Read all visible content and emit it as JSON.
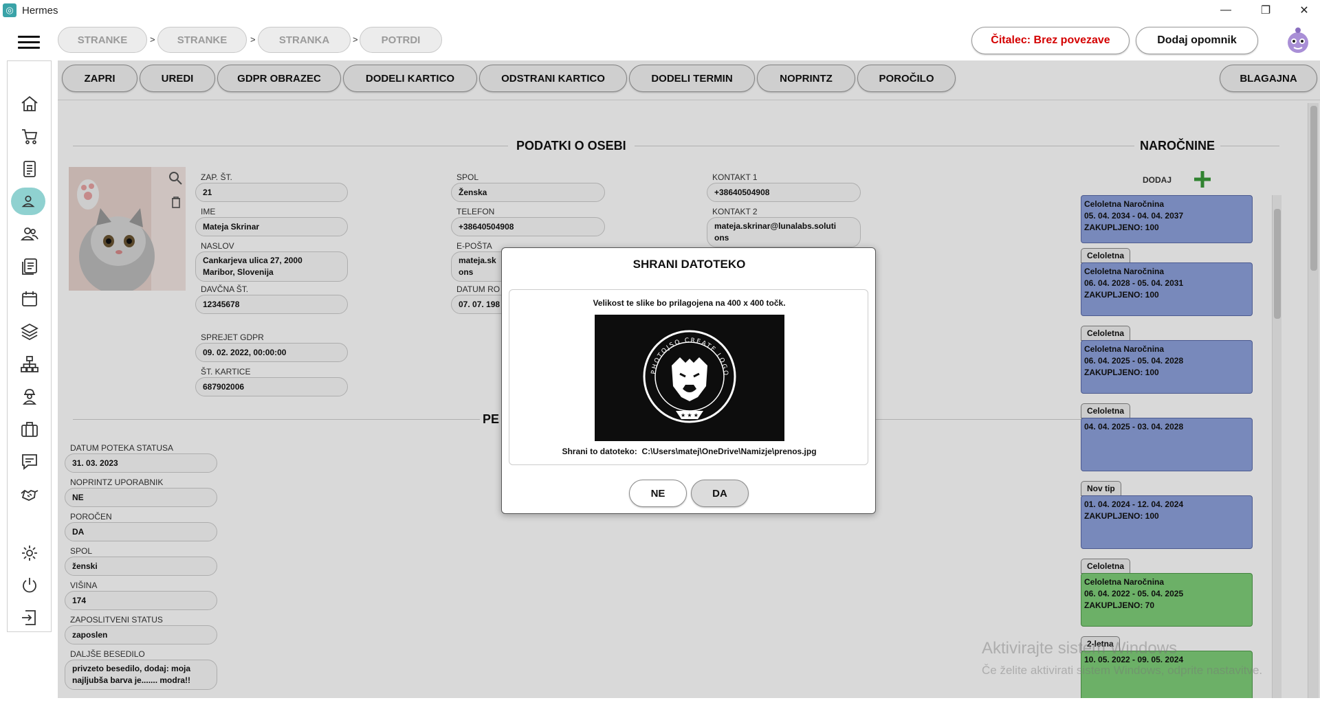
{
  "window": {
    "title": "Hermes"
  },
  "breadcrumbs": [
    "STRANKE",
    "STRANKE",
    "STRANKA",
    "POTRDI"
  ],
  "breadcrumb_sep": ">",
  "top_actions": {
    "reader": "Čitalec: Brez povezave",
    "reader_color": "#d40000",
    "reminder": "Dodaj opomnik"
  },
  "toolbar": [
    "ZAPRI",
    "UREDI",
    "GDPR OBRAZEC",
    "DODELI KARTICO",
    "ODSTRANI KARTICO",
    "DODELI TERMIN",
    "NOPRINTZ",
    "POROČILO"
  ],
  "toolbar_right": "BLAGAJNA",
  "person": {
    "title": "PODATKI O OSEBI",
    "col1": [
      {
        "label": "ZAP. ŠT.",
        "value": "21"
      },
      {
        "label": "IME",
        "value": "Mateja Skrinar"
      },
      {
        "label": "NASLOV",
        "value": "Cankarjeva ulica 27, 2000\nMaribor, Slovenija"
      },
      {
        "label": "DAVČNA ŠT.",
        "value": "12345678"
      },
      {
        "label": "SPREJET GDPR",
        "value": "09. 02. 2022, 00:00:00"
      },
      {
        "label": "ŠT. KARTICE",
        "value": "687902006"
      }
    ],
    "col2": [
      {
        "label": "SPOL",
        "value": "Ženska"
      },
      {
        "label": "TELEFON",
        "value": "+38640504908"
      },
      {
        "label": "E-POŠTA",
        "value": "mateja.sk\nons"
      },
      {
        "label": "DATUM RO",
        "value": "07. 07. 198"
      }
    ],
    "col3": [
      {
        "label": "KONTAKT 1",
        "value": "+38640504908"
      },
      {
        "label": "KONTAKT 2",
        "value": "mateja.skrinar@lunalabs.soluti\nons"
      }
    ]
  },
  "personal_section_title": "PE",
  "extra_fields": [
    {
      "label": "DATUM POTEKA STATUSA",
      "value": "31. 03. 2023"
    },
    {
      "label": "NOPRINTZ UPORABNIK",
      "value": "NE"
    },
    {
      "label": "POROČEN",
      "value": "DA"
    },
    {
      "label": "SPOL",
      "value": "ženski"
    },
    {
      "label": "VIŠINA",
      "value": "174"
    },
    {
      "label": "ZAPOSLITVENI STATUS",
      "value": "zaposlen"
    },
    {
      "label": "DALJŠE BESEDILO",
      "value": "privzeto besedilo, dodaj: moja\nnajljubša barva je....... modra!!"
    }
  ],
  "subscriptions": {
    "title": "NAROČNINE",
    "add_label": "DODAJ",
    "items": [
      {
        "tab": "",
        "lines": [
          "Celoletna Naročnina",
          "05. 04. 2034 - 04. 04. 2037",
          "ZAKUPLJENO: 100"
        ],
        "color": "#8ea2dc"
      },
      {
        "tab": "Celoletna",
        "lines": [
          "Celoletna Naročnina",
          "06. 04. 2028 - 05. 04. 2031",
          "ZAKUPLJENO: 100"
        ],
        "color": "#8ea2dc"
      },
      {
        "tab": "Celoletna",
        "lines": [
          "Celoletna Naročnina",
          "06. 04. 2025 - 05. 04. 2028",
          "ZAKUPLJENO: 100"
        ],
        "color": "#8ea2dc"
      },
      {
        "tab": "Celoletna",
        "lines": [
          "04. 04. 2025 - 03. 04. 2028"
        ],
        "color": "#8ea2dc"
      },
      {
        "tab": "Nov tip",
        "lines": [
          "01. 04. 2024 - 12. 04. 2024",
          "ZAKUPLJENO: 100"
        ],
        "color": "#8ea2dc"
      },
      {
        "tab": "Celoletna",
        "lines": [
          "Celoletna Naročnina",
          "06. 04. 2022 - 05. 04. 2025",
          "ZAKUPLJENO: 70"
        ],
        "color": "#7fcf7a"
      },
      {
        "tab": "2-letna",
        "lines": [
          "10. 05. 2022 - 09. 05. 2024"
        ],
        "color": "#7fcf7a"
      }
    ]
  },
  "dialog": {
    "title": "SHRANI DATOTEKO",
    "message": "Velikost te slike bo prilagojena na 400 x 400 točk.",
    "path_label": "Shrani to datoteko:",
    "path": "C:\\Users\\matej\\OneDrive\\Namizje\\prenos.jpg",
    "preview_logo_text": "PHOTOJSO CREATE LOGO ONLINE",
    "no": "NE",
    "yes": "DA"
  },
  "watermark": {
    "line1": "Aktivirajte sistem Windows",
    "line2": "Če želite aktivirati sistem Windows, odprite nastavitve."
  },
  "sidebar_icons": [
    "home-icon",
    "cart-icon",
    "document-icon",
    "person-icon",
    "people-icon",
    "list-icon",
    "calendar-icon",
    "layers-icon",
    "hierarchy-icon",
    "worker-icon",
    "briefcase-icon",
    "chat-icon",
    "handshake-icon",
    "settings-icon",
    "power-icon",
    "logout-icon"
  ],
  "colors": {
    "active_nav": "#8fd1d0",
    "add_plus": "#3a9a3a"
  }
}
